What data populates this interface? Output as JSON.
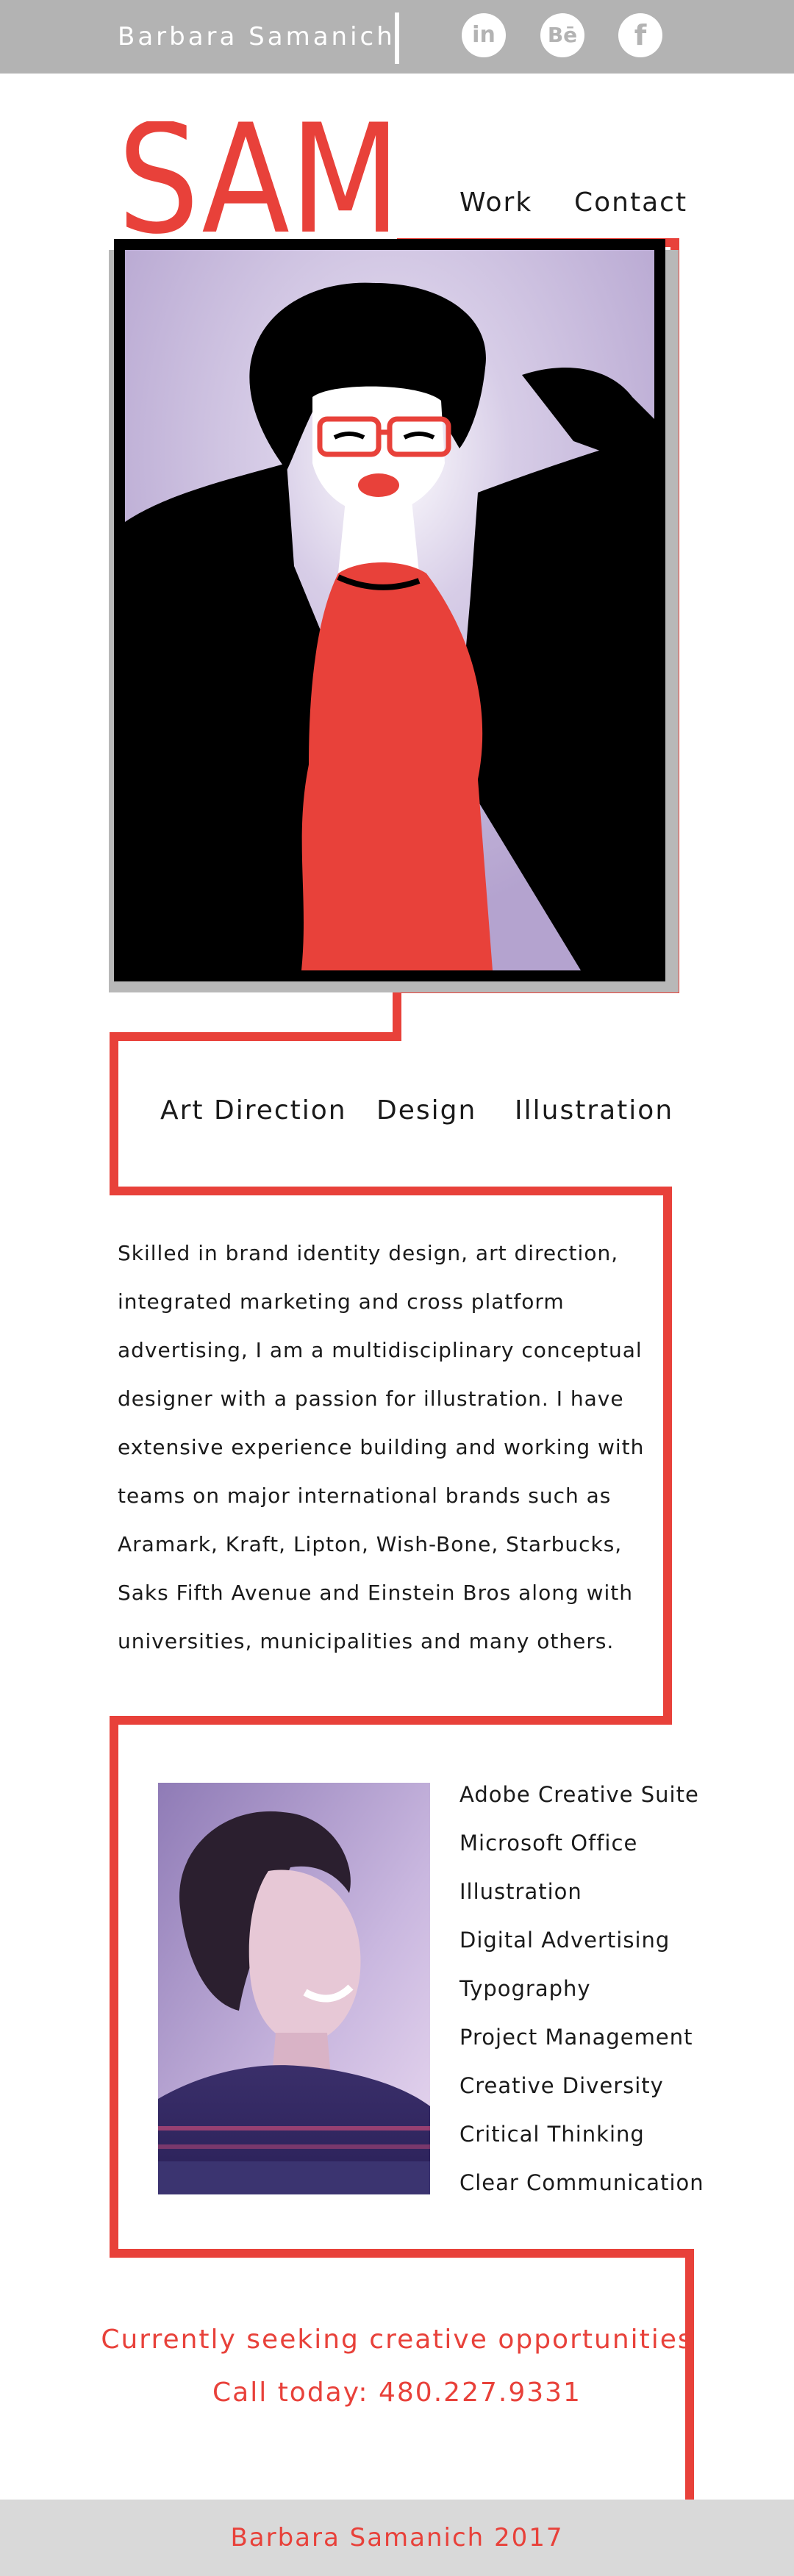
{
  "header": {
    "name": "Barbara Samanich",
    "social": [
      {
        "icon": "linkedin-icon",
        "glyph": "in"
      },
      {
        "icon": "behance-icon",
        "glyph": "Bē"
      },
      {
        "icon": "facebook-icon",
        "glyph": "f"
      }
    ]
  },
  "logo": {
    "text": "SAM"
  },
  "nav": {
    "work": "Work",
    "contact": "Contact"
  },
  "services": [
    "Art Direction",
    "Design",
    "Illustration"
  ],
  "bio": [
    "Skilled in brand identity design, art direction,",
    "integrated marketing and cross platform",
    "advertising, I am a multidisciplinary conceptual",
    "designer with a passion for illustration. I have",
    "extensive experience building and working with",
    "teams on major international brands such as",
    "Aramark, Kraft, Lipton, Wish-Bone, Starbucks,",
    "Saks Fifth Avenue and Einstein Bros along with",
    "universities, municipalities and many others."
  ],
  "skills": [
    "Adobe Creative Suite",
    "Microsoft Office",
    "Illustration",
    "Digital Advertising",
    "Typography",
    "Project Management",
    "Creative Diversity",
    "Critical Thinking",
    "Clear Communication"
  ],
  "cta": {
    "line1": "Currently seeking creative opportunities",
    "line2": "Call today: 480.227.9331"
  },
  "footer": {
    "text": "Barbara Samanich 2017"
  },
  "colors": {
    "accent": "#e8413a",
    "header_bg": "#b3b3b3",
    "footer_bg": "#d9d9d9",
    "hero_bg": "#b9a9d2"
  }
}
